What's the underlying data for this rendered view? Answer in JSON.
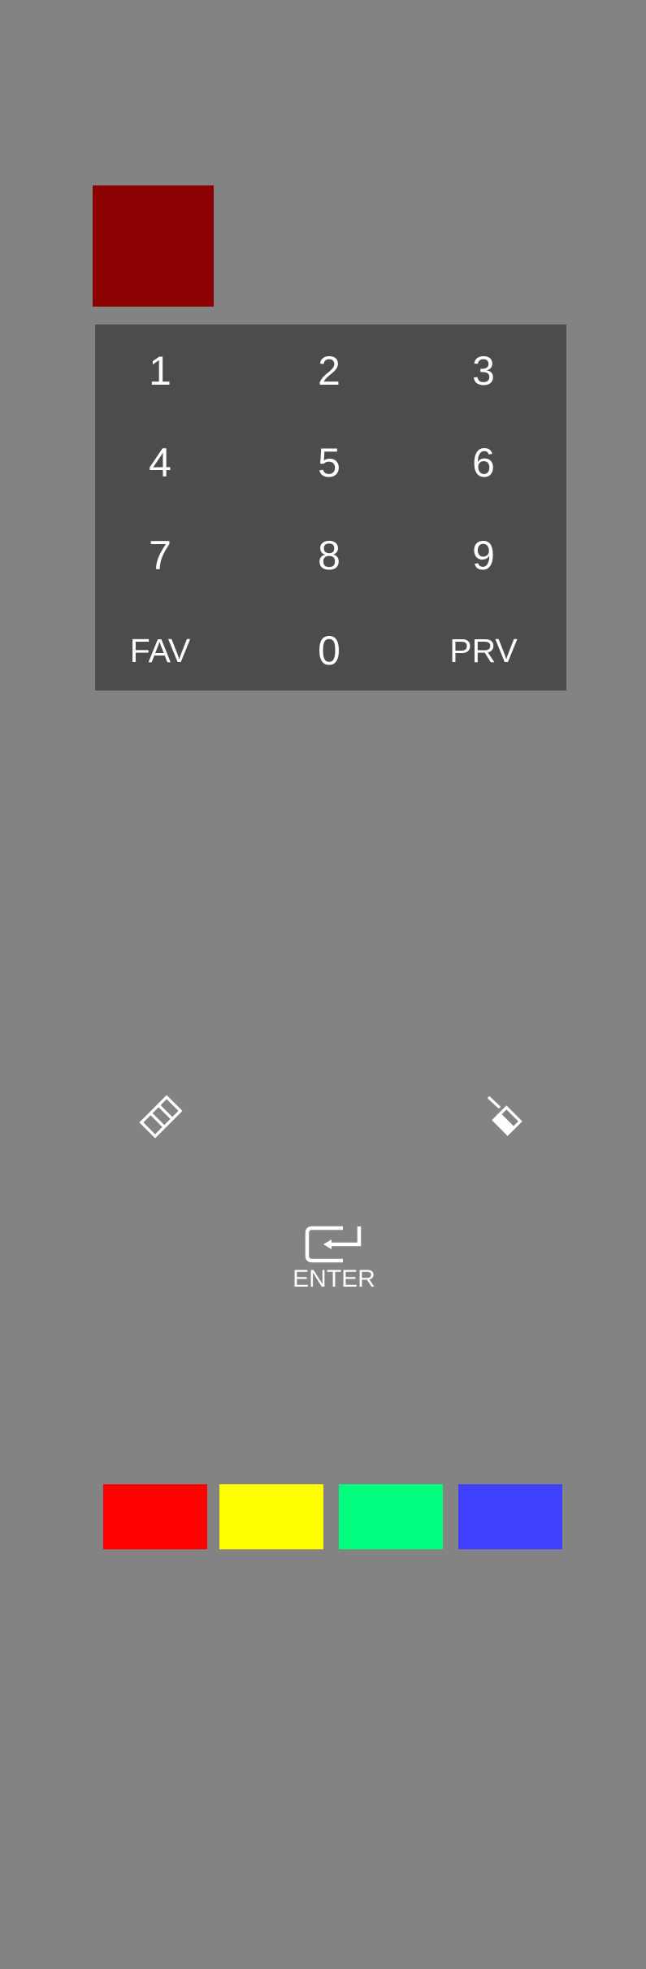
{
  "power": {
    "icon": "power-square",
    "color": "#8b0000"
  },
  "keypad": {
    "background": "#4c4c4c",
    "keys": {
      "k1": "1",
      "k2": "2",
      "k3": "3",
      "k4": "4",
      "k5": "5",
      "k6": "6",
      "k7": "7",
      "k8": "8",
      "k9": "9",
      "fav": "FAV",
      "k0": "0",
      "prv": "PRV"
    }
  },
  "icons": {
    "left": "film-strip-icon",
    "right": "paint-bucket-icon"
  },
  "enter": {
    "label": "ENTER",
    "icon": "enter-icon"
  },
  "color_buttons": {
    "red": "#ff0000",
    "yellow": "#ffff00",
    "green": "#00ff7f",
    "blue": "#4040ff"
  },
  "background": "#838383"
}
